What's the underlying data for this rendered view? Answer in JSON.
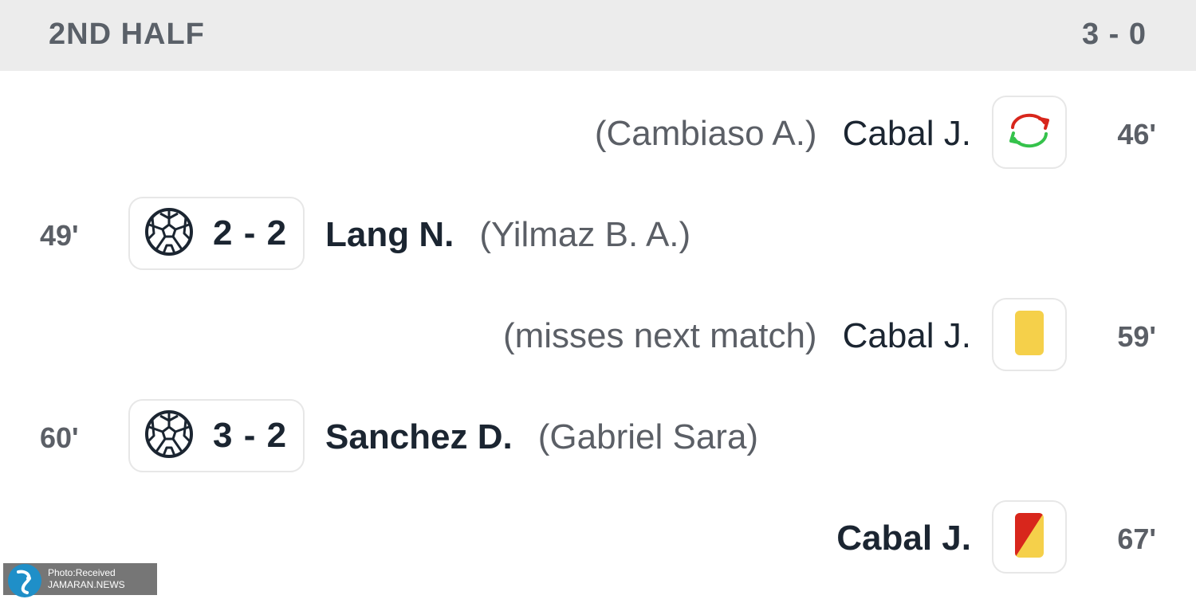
{
  "header": {
    "title": "2ND HALF",
    "score": "3 - 0"
  },
  "events": [
    {
      "side": "away",
      "minute": "46'",
      "player": "Cabal J.",
      "detail": "(Cambiaso A.)",
      "type": "substitution",
      "icon": "substitution-icon"
    },
    {
      "side": "home",
      "minute": "49'",
      "score": "2 - 2",
      "player": "Lang N.",
      "detail": "(Yilmaz B. A.)",
      "type": "goal",
      "icon": "soccer-ball-icon"
    },
    {
      "side": "away",
      "minute": "59'",
      "player": "Cabal J.",
      "detail": "(misses next match)",
      "type": "yellow-card",
      "icon": "yellow-card-icon"
    },
    {
      "side": "home",
      "minute": "60'",
      "score": "3 - 2",
      "player": "Sanchez D.",
      "detail": "(Gabriel Sara)",
      "type": "goal",
      "icon": "soccer-ball-icon"
    },
    {
      "side": "away",
      "minute": "67'",
      "player": "Cabal J.",
      "detail": "",
      "type": "second-yellow-red-card",
      "icon": "second-yellow-red-card-icon"
    }
  ],
  "watermark": {
    "line1": "Photo:Received",
    "line2": "JAMARAN.NEWS"
  },
  "colors": {
    "header_bg": "#ececec",
    "header_text": "#5a6068",
    "player_text": "#1b2531",
    "detail_text": "#5b5f66",
    "yellow_card": "#f5d04a",
    "red_card": "#d8261c",
    "sub_in": "#35c24b",
    "sub_out": "#d8261c"
  }
}
